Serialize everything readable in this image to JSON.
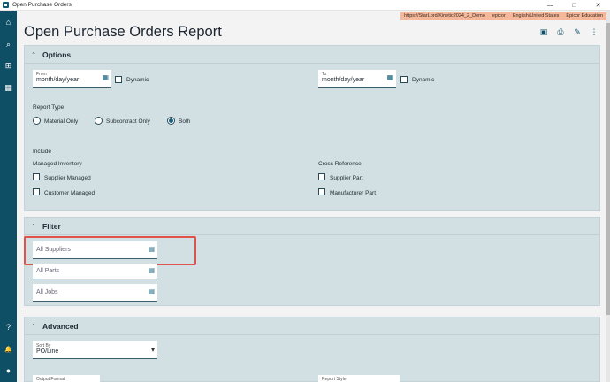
{
  "window": {
    "title": "Open Purchase Orders",
    "minimize": "—",
    "maximize": "□",
    "close": "✕"
  },
  "env": {
    "url": "https://StarLord/Kinetic2024_2_Demo",
    "user": "epicor",
    "language": "English/United States",
    "company": "Epicor Education"
  },
  "page": {
    "title": "Open Purchase Orders Report"
  },
  "options": {
    "title": "Options",
    "from_label": "From",
    "from_value": "month/day/year",
    "to_label": "To",
    "to_value": "month/day/year",
    "dynamic": "Dynamic",
    "report_type_label": "Report Type",
    "report_types": [
      "Material Only",
      "Subcontract Only",
      "Both"
    ],
    "report_type_selected": "Both",
    "include_label": "Include",
    "managed_inventory_label": "Managed Inventory",
    "supplier_managed": "Supplier Managed",
    "customer_managed": "Customer Managed",
    "cross_reference_label": "Cross Reference",
    "supplier_part": "Supplier Part",
    "manufacturer_part": "Manufacturer Part"
  },
  "filter": {
    "title": "Filter",
    "all_suppliers": "All Suppliers",
    "all_parts": "All Parts",
    "all_jobs": "All Jobs"
  },
  "advanced": {
    "title": "Advanced",
    "sort_by_label": "Sort By",
    "sort_by_value": "PO/Line",
    "output_format_label": "Output Format",
    "report_style_label": "Report Style"
  },
  "icons": {
    "home": "⌂",
    "search": "⌕",
    "apps": "⊞",
    "dashboard": "▦",
    "help": "?",
    "bell": "🔔",
    "user": "●",
    "calendar": "▦",
    "lookup": "▤",
    "chevron_up": "⌃",
    "dropdown": "▾"
  }
}
